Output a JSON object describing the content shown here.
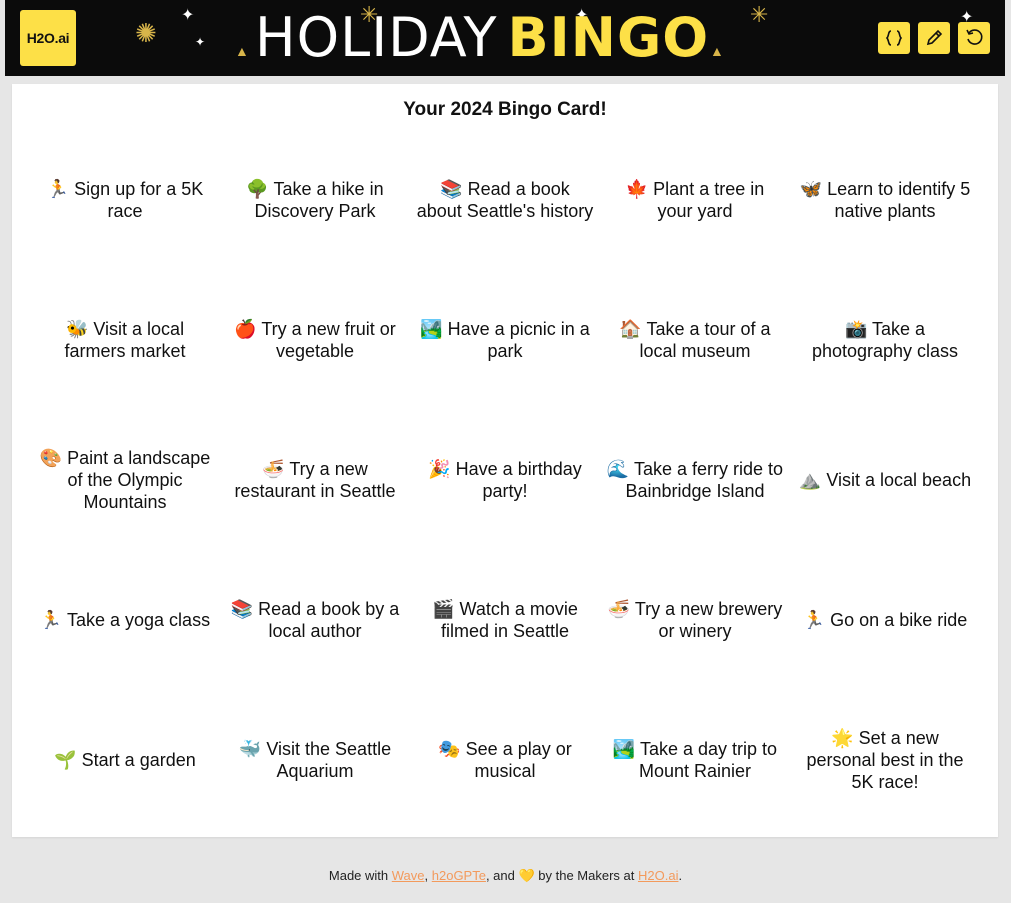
{
  "header": {
    "logo_text": "H2O.ai",
    "title_part1": "HOLIDAY",
    "title_part2": "BINGO",
    "buttons": [
      {
        "name": "code-braces-icon"
      },
      {
        "name": "pencil-icon"
      },
      {
        "name": "undo-icon"
      }
    ]
  },
  "card": {
    "title": "Your 2024 Bingo Card!",
    "cells": [
      "🏃 Sign up for a 5K race",
      "🌳 Take a hike in Discovery Park",
      "📚 Read a book about Seattle's history",
      "🍁 Plant a tree in your yard",
      "🦋 Learn to identify 5 native plants",
      "🐝 Visit a local farmers market",
      "🍎 Try a new fruit or vegetable",
      "🏞️ Have a picnic in a park",
      "🏠 Take a tour of a local museum",
      "📸 Take a photography class",
      "🎨 Paint a landscape of the Olympic Mountains",
      "🍜 Try a new restaurant in Seattle",
      "🎉 Have a birthday party!",
      "🌊 Take a ferry ride to Bainbridge Island",
      "⛰️ Visit a local beach",
      "🏃 Take a yoga class",
      "📚 Read a book by a local author",
      "🎬 Watch a movie filmed in Seattle",
      "🍜 Try a new brewery or winery",
      "🏃 Go on a bike ride",
      "🌱 Start a garden",
      "🐳 Visit the Seattle Aquarium",
      "🎭 See a play or musical",
      "🏞️ Take a day trip to Mount Rainier",
      "🌟 Set a new personal best in the 5K race!"
    ]
  },
  "footer": {
    "prefix": "Made with ",
    "link1": "Wave",
    "sep1": ", ",
    "link2": "h2oGPTe",
    "sep2": ", and ",
    "heart": "💛",
    "mid": " by the Makers at ",
    "link3": "H2O.ai",
    "suffix": "."
  },
  "colors": {
    "accent": "#fde047",
    "header_bg": "#0b0b0b",
    "link": "#f39a5c",
    "page_bg": "#e6e6e6"
  }
}
